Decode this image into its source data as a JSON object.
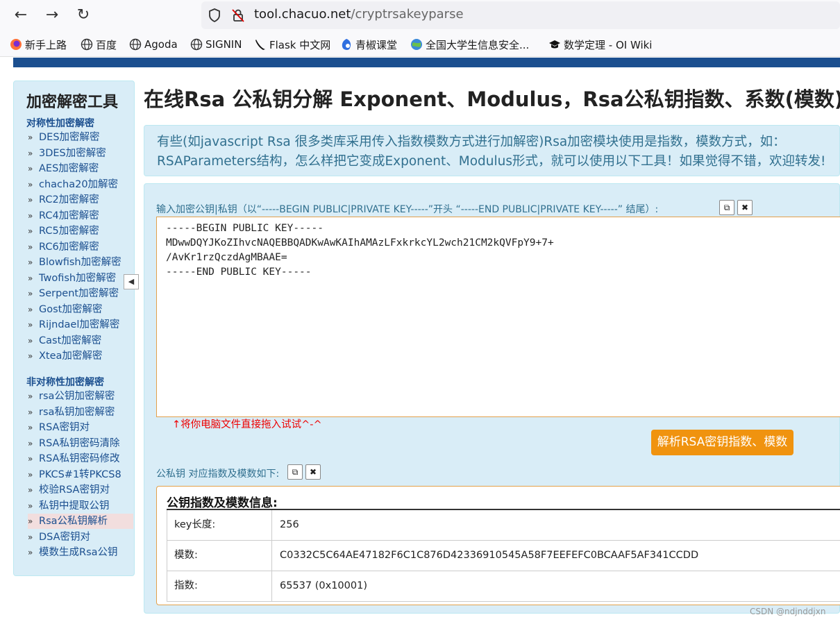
{
  "browser": {
    "url_host": "tool.chacuo.net",
    "url_path": "/cryptrsakeyparse",
    "bookmarks": [
      "新手上路",
      "百度",
      "Agoda",
      "SIGNIN",
      "Flask 中文网",
      "青椒课堂",
      "全国大学生信息安全...",
      "数学定理 - OI Wiki"
    ]
  },
  "sidebar": {
    "title": "加密解密工具",
    "group1": "对称性加密解密",
    "group1_items": [
      "DES加密解密",
      "3DES加密解密",
      "AES加密解密",
      "chacha20加解密",
      "RC2加密解密",
      "RC4加密解密",
      "RC5加密解密",
      "RC6加密解密",
      "Blowfish加密解密",
      "Twofish加密解密",
      "Serpent加密解密",
      "Gost加密解密",
      "Rijndael加密解密",
      "Cast加密解密",
      "Xtea加密解密"
    ],
    "group2": "非对称性加密解密",
    "group2_items": [
      "rsa公钥加密解密",
      "rsa私钥加密解密",
      "RSA密钥对",
      "RSA私钥密码清除",
      "RSA私钥密码修改",
      "PKCS#1转PKCS8",
      "校验RSA密钥对",
      "私钥中提取公钥",
      "Rsa公私钥解析",
      "DSA密钥对",
      "模数生成Rsa公钥"
    ],
    "active_item": "Rsa公私钥解析"
  },
  "main": {
    "title": "在线Rsa 公私钥分解 Exponent、Modulus，Rsa公私钥指数、系数(模数)分",
    "info": "有些(如javascript Rsa 很多类库采用传入指数模数方式进行加解密)Rsa加密模块使用是指数，模数方式，如：RSAParameters结构，怎么样把它变成Exponent、Modulus形式，就可以使用以下工具！如果觉得不错，欢迎转发!",
    "input_label": "输入加密公钥|私钥（以“-----BEGIN PUBLIC|PRIVATE KEY-----”开头 “-----END PUBLIC|PRIVATE KEY-----” 结尾）:",
    "key_text": "-----BEGIN PUBLIC KEY-----\nMDwwDQYJKoZIhvcNAQEBBQADKwAwKAIhAMAzLFxkrkcYL2wch21CM2kQVFpY9+7+\n/AvKr1rzQczdAgMBAAE=\n-----END PUBLIC KEY-----",
    "drag_hint": "↑将你电脑文件直接拖入试试^-^",
    "parse_button": "解析RSA密钥指数、模数",
    "output_label": "公私钥 对应指数及模数如下:",
    "result_title": "公钥指数及模数信息:",
    "rows": [
      {
        "k": "key长度:",
        "v": "256"
      },
      {
        "k": "模数:",
        "v": "C0332C5C64AE47182F6C1C876D42336910545A58F7EEFEFC0BCAAF5AF341CCDD"
      },
      {
        "k": "指数:",
        "v": "65537 (0x10001)"
      }
    ]
  },
  "watermark": "CSDN @ndjnddjxn"
}
